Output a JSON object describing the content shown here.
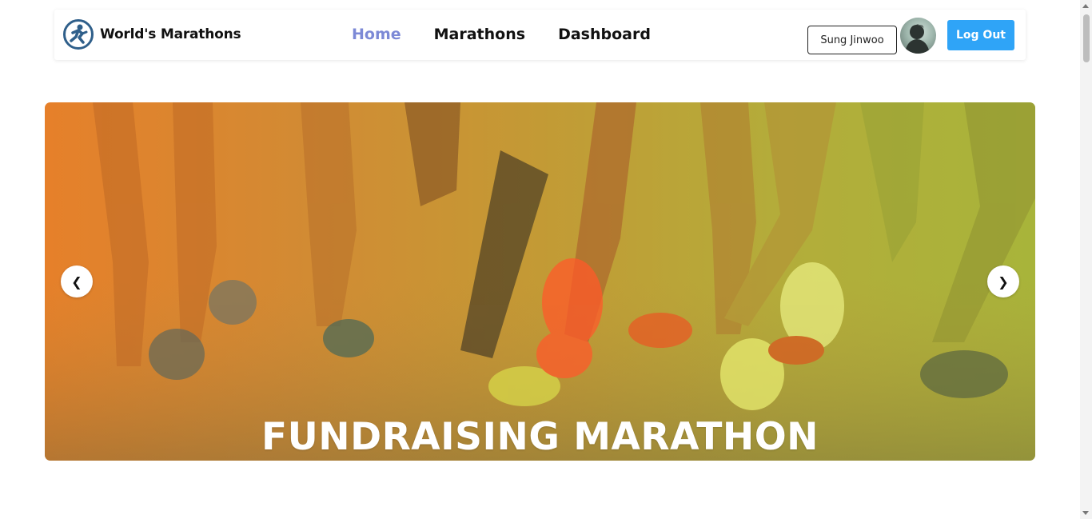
{
  "brand": {
    "name": "World's Marathons",
    "logo_icon": "runner-logo-icon"
  },
  "nav": {
    "links": [
      {
        "label": "Home",
        "active": true
      },
      {
        "label": "Marathons",
        "active": false
      },
      {
        "label": "Dashboard",
        "active": false
      }
    ]
  },
  "user": {
    "name": "Sung Jinwoo",
    "avatar_icon": "user-avatar-icon"
  },
  "auth": {
    "logout_label": "Log Out"
  },
  "carousel": {
    "slide_title": "FUNDRAISING MARATHON",
    "prev_symbol": "❮",
    "next_symbol": "❯"
  },
  "colors": {
    "accent": "#2fa4f7",
    "active_link": "#7c89d6",
    "logo_blue": "#2f5f8a"
  }
}
